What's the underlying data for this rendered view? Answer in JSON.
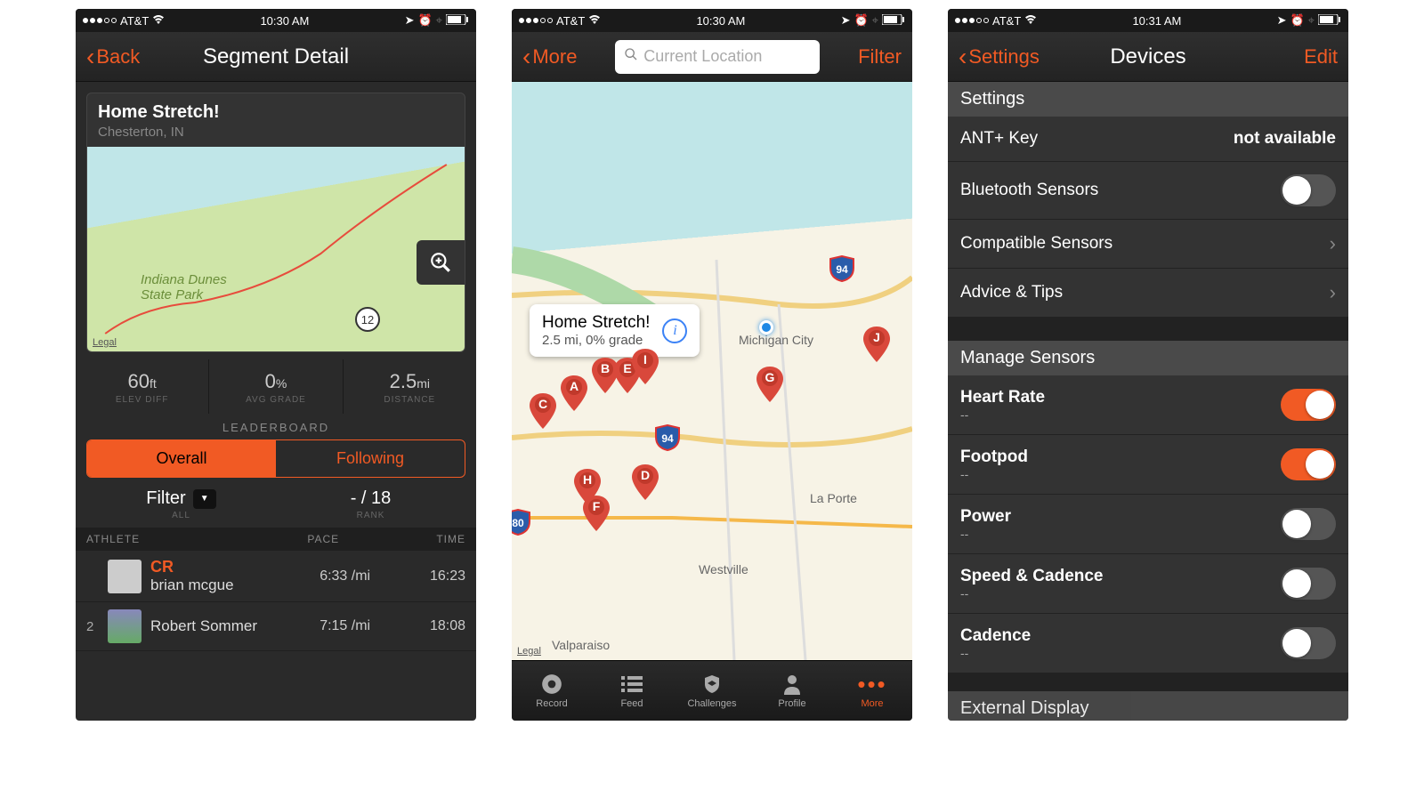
{
  "status": {
    "carrier": "AT&T",
    "time1": "10:30 AM",
    "time2": "10:30 AM",
    "time3": "10:31 AM"
  },
  "screen1": {
    "back_label": "Back",
    "title": "Segment Detail",
    "segment": {
      "name": "Home Stretch!",
      "location": "Chesterton, IN",
      "park_label": "Indiana Dunes\nState Park",
      "route_marker": "12",
      "legal": "Legal"
    },
    "stats": [
      {
        "value": "60",
        "unit": "ft",
        "label": "ELEV DIFF"
      },
      {
        "value": "0",
        "unit": "%",
        "label": "AVG GRADE"
      },
      {
        "value": "2.5",
        "unit": "mi",
        "label": "DISTANCE"
      }
    ],
    "leaderboard_label": "LEADERBOARD",
    "tabs": {
      "overall": "Overall",
      "following": "Following"
    },
    "filter": {
      "label": "Filter",
      "sublabel": "ALL",
      "rank_value": "- / 18",
      "rank_label": "RANK"
    },
    "columns": {
      "athlete": "ATHLETE",
      "pace": "PACE",
      "time": "TIME"
    },
    "rows": [
      {
        "rank": "",
        "cr": "CR",
        "name": "brian mcgue",
        "pace": "6:33 /mi",
        "time": "16:23"
      },
      {
        "rank": "2",
        "cr": "",
        "name": "Robert Sommer",
        "pace": "7:15 /mi",
        "time": "18:08"
      }
    ]
  },
  "screen2": {
    "back_label": "More",
    "search_placeholder": "Current Location",
    "filter_label": "Filter",
    "callout": {
      "title": "Home Stretch!",
      "sub": "2.5 mi, 0% grade"
    },
    "legal": "Legal",
    "pins": [
      "A",
      "B",
      "C",
      "D",
      "E",
      "F",
      "G",
      "H",
      "I",
      "J"
    ],
    "cities": {
      "michigan_city": "Michigan City",
      "la_porte": "La Porte",
      "westville": "Westville",
      "valparaiso": "Valparaiso",
      "chesterton": ""
    },
    "interstates": [
      "94",
      "94",
      "80"
    ],
    "tabs": [
      {
        "label": "Record"
      },
      {
        "label": "Feed"
      },
      {
        "label": "Challenges"
      },
      {
        "label": "Profile"
      },
      {
        "label": "More"
      }
    ]
  },
  "screen3": {
    "back_label": "Settings",
    "title": "Devices",
    "edit_label": "Edit",
    "section1_title": "Settings",
    "rows1": [
      {
        "label": "ANT+ Key",
        "value": "not available",
        "type": "value"
      },
      {
        "label": "Bluetooth Sensors",
        "on": false,
        "type": "toggle"
      },
      {
        "label": "Compatible Sensors",
        "type": "chevron"
      },
      {
        "label": "Advice & Tips",
        "type": "chevron"
      }
    ],
    "section2_title": "Manage Sensors",
    "rows2": [
      {
        "label": "Heart Rate",
        "sub": "--",
        "on": true
      },
      {
        "label": "Footpod",
        "sub": "--",
        "on": true
      },
      {
        "label": "Power",
        "sub": "--",
        "on": false
      },
      {
        "label": "Speed & Cadence",
        "sub": "--",
        "on": false
      },
      {
        "label": "Cadence",
        "sub": "--",
        "on": false
      }
    ],
    "section3_title": "External Display"
  }
}
